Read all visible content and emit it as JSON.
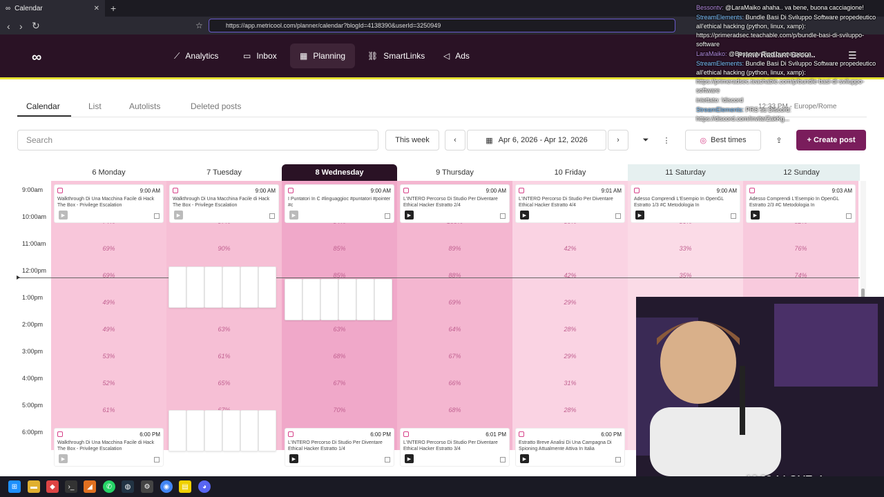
{
  "browser": {
    "tab_title": "Calendar",
    "url": "https://app.metricool.com/planner/calendar?blogId=4138390&userId=3250949"
  },
  "app_nav": {
    "items": [
      {
        "label": "Analytics"
      },
      {
        "label": "Inbox"
      },
      {
        "label": "Planning",
        "active": true
      },
      {
        "label": "SmartLinks"
      },
      {
        "label": "Ads"
      }
    ],
    "brand": "Prime Radiant Secu...",
    "timezone": "12:33 PM - Europe/Rome"
  },
  "subtabs": [
    "Calendar",
    "List",
    "Autolists",
    "Deleted posts"
  ],
  "toolbar": {
    "search_placeholder": "Search",
    "this_week": "This week",
    "date_range": "Apr 6, 2026 - Apr 12, 2026",
    "best_times": "Best times",
    "create_post": "+ Create post"
  },
  "days": [
    "6 Monday",
    "7 Tuesday",
    "8 Wednesday",
    "9 Thursday",
    "10 Friday",
    "11 Saturday",
    "12 Sunday"
  ],
  "hours": [
    "9:00am",
    "10:00am",
    "11:00am",
    "12:00pm",
    "1:00pm",
    "2:00pm",
    "3:00pm",
    "4:00pm",
    "5:00pm",
    "6:00pm"
  ],
  "best_times": [
    [
      "",
      "74%",
      "69%",
      "69%",
      "49%",
      "49%",
      "53%",
      "52%",
      "61%",
      ""
    ],
    [
      "",
      "97%",
      "90%",
      "",
      "",
      "63%",
      "61%",
      "65%",
      "67%",
      ""
    ],
    [
      "",
      "94%",
      "85%",
      "85%",
      "",
      "63%",
      "68%",
      "67%",
      "70%",
      ""
    ],
    [
      "",
      "100%",
      "89%",
      "88%",
      "69%",
      "64%",
      "67%",
      "66%",
      "68%",
      ""
    ],
    [
      "",
      "50%",
      "42%",
      "42%",
      "29%",
      "28%",
      "29%",
      "31%",
      "28%",
      ""
    ],
    [
      "",
      "36%",
      "33%",
      "35%",
      "",
      "",
      "",
      "",
      "",
      ""
    ],
    [
      "",
      "82%",
      "76%",
      "74%",
      "",
      "",
      "",
      "",
      "",
      ""
    ]
  ],
  "posts_top": [
    {
      "time": "9:00 AM",
      "title": "Walkthrough Di Una Macchina Facile di Hack The Box - Privilege Escalation"
    },
    {
      "time": "9:00 AM",
      "title": "Walkthrough Di Una Macchina Facile di Hack The Box - Privilege Escalation"
    },
    {
      "time": "9:00 AM",
      "title": "I Puntatori In C #linguaggioc #puntatori #pointer #c"
    },
    {
      "time": "9:00 AM",
      "title": "L'INTERO Percorso Di Studio Per Diventare Ethical Hacker Estratto 2/4"
    },
    {
      "time": "9:01 AM",
      "title": "L'INTERO Percorso Di Studio Per Diventare Ethical Hacker Estratto 4/4"
    },
    {
      "time": "9:00 AM",
      "title": "Adesso Comprendi L'Esempio In OpenGL Estratto 1/3 #C Metodologia In"
    },
    {
      "time": "9:03 AM",
      "title": "Adesso Comprendi L'Esempio In OpenGL Estratto 2/3 #C Metodologia In"
    }
  ],
  "posts_bottom": [
    {
      "time": "6:00 PM",
      "title": "Walkthrough Di Una Macchina Facile di Hack The Box - Privilege Escalation"
    },
    {
      "time": "6:00 PM",
      "title": "L'INTERO Percorso Di Studio Per Diventare Ethical Hacker Estratto 1/4"
    },
    {
      "time": "6:01 PM",
      "title": "L'INTERO Percorso Di Studio Per Diventare Ethical Hacker Estratto 3/4"
    },
    {
      "time": "6:00 PM",
      "title": "Estratto Breve Analisi Di Una Campagna Di Spioning Attualmente Attiva In Italia"
    }
  ],
  "chat": [
    {
      "user": "Bessontv:",
      "text": "@LaraMaiko ahaha.. va bene, buona cacciagione!"
    },
    {
      "user": "StreamElements:",
      "text": "Bundle Basi Di Sviluppo Software propedeutico all'ethical hacking (python, linux, xamp): https://primeradsec.teachable.com/p/bundle-basi-di-sviluppo-software"
    },
    {
      "user": "LaraMaiko:",
      "text": "@Bessontv Tipo buona pesca"
    },
    {
      "user": "StreamElements:",
      "text": "Bundle Basi Di Sviluppo Software propedeutico all'ethical hacking (python, linux, xamp): https://primeradsec.teachable.com/p/bundle-basi-di-sviluppo-software"
    },
    {
      "user": "",
      "text": "iniettato: !discord"
    },
    {
      "user": "StreamElements:",
      "text": "PRS su Discord: https://discord.com/invite/ZakKg..."
    }
  ],
  "stream_clock": "12:33:14 GMT+1"
}
